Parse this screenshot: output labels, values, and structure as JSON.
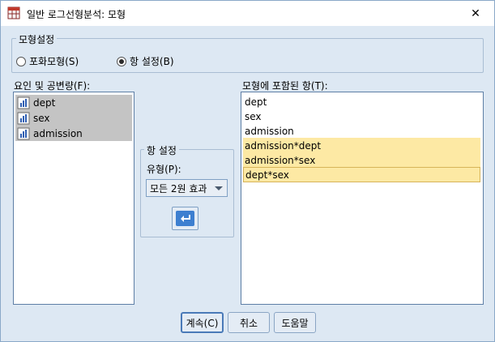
{
  "window": {
    "title": "일반 로그선형분석: 모형",
    "close_symbol": "✕"
  },
  "model_group": {
    "legend": "모형설정",
    "options": [
      {
        "label": "포화모형(S)",
        "checked": false
      },
      {
        "label": "항 설정(B)",
        "checked": true
      }
    ]
  },
  "factors": {
    "label": "요인 및 공변량(F):",
    "items": [
      "dept",
      "sex",
      "admission"
    ]
  },
  "build_group": {
    "legend": "항 설정",
    "type_label": "유형(P):",
    "type_value": "모든 2원 효과"
  },
  "terms": {
    "label": "모형에 포함된 항(T):",
    "items": [
      {
        "text": "dept",
        "selected": false
      },
      {
        "text": "sex",
        "selected": false
      },
      {
        "text": "admission",
        "selected": false
      },
      {
        "text": "admission*dept",
        "selected": true
      },
      {
        "text": "admission*sex",
        "selected": true
      },
      {
        "text": "dept*sex",
        "selected": true
      }
    ]
  },
  "buttons": {
    "continue": "계속(C)",
    "cancel": "취소",
    "help": "도움말"
  },
  "colors": {
    "dialog_bg": "#dde8f3",
    "selection": "#fde9a4",
    "accent_blue": "#3d7fd0"
  }
}
